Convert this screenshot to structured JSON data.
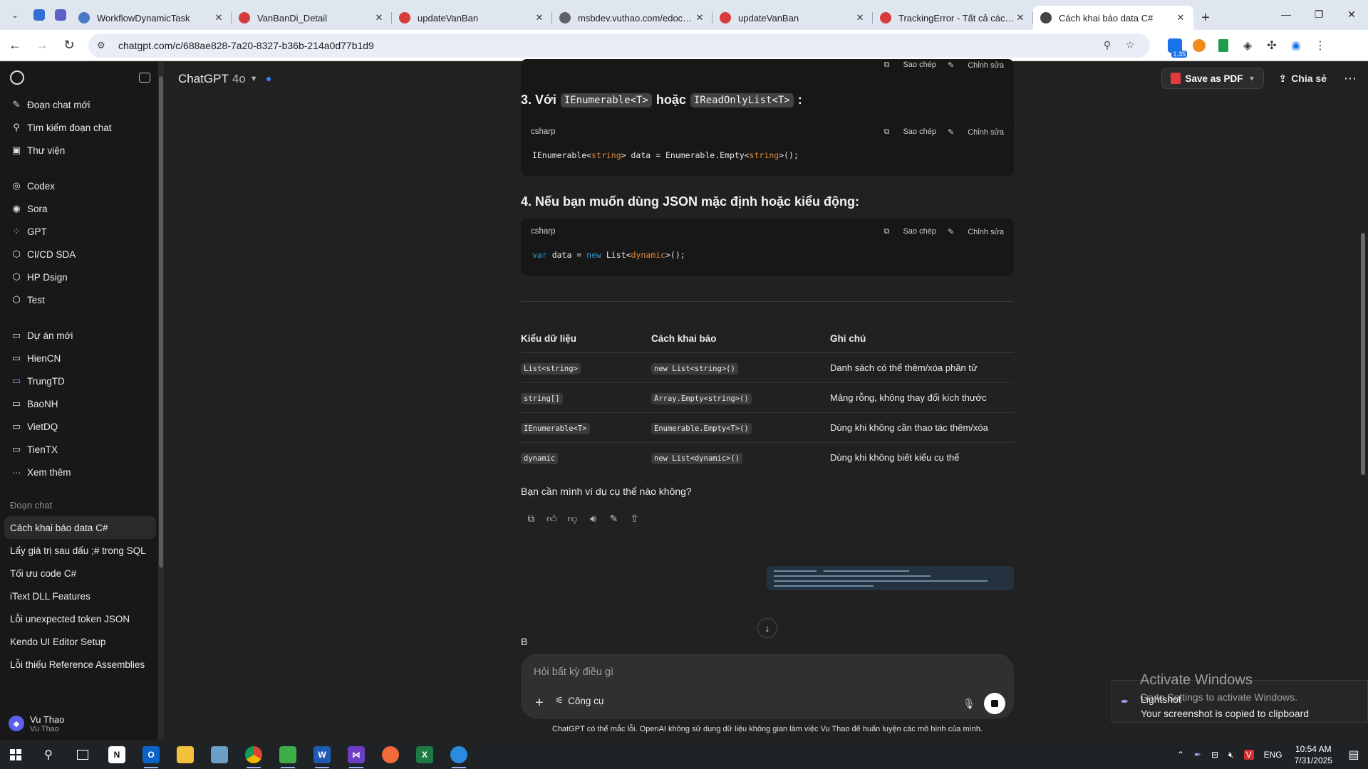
{
  "browser": {
    "tabs": [
      {
        "title": "WorkflowDynamicTask",
        "favicon_color": "#4a78c2"
      },
      {
        "title": "VanBanDi_Detail",
        "favicon_color": "#d83b3b"
      },
      {
        "title": "updateVanBan",
        "favicon_color": "#d83b3b"
      },
      {
        "title": "msbdev.vuthao.com/edoc/va",
        "favicon_color": "#5f6368"
      },
      {
        "title": "updateVanBan",
        "favicon_color": "#d83b3b"
      },
      {
        "title": "TrackingError - Tất cả các Kh",
        "favicon_color": "#d83b3b"
      },
      {
        "title": "Cách khai báo data C#",
        "favicon_color": "#444444"
      }
    ],
    "url": "chatgpt.com/c/688ae828-7a20-8327-b36b-214a0d77b1d9",
    "extension_badge": "1.35",
    "close_glyph": "✕",
    "new_tab_glyph": "+"
  },
  "sidebar": {
    "top_items": [
      {
        "label": "Đoạn chat mới",
        "icon": "✎"
      },
      {
        "label": "Tìm kiếm đoạn chat",
        "icon": "⚲"
      },
      {
        "label": "Thư viện",
        "icon": "▣"
      }
    ],
    "gpt_items": [
      {
        "label": "Codex",
        "icon": "◎"
      },
      {
        "label": "Sora",
        "icon": "◉"
      },
      {
        "label": "GPT",
        "icon": "⁘"
      },
      {
        "label": "CI/CD SDA",
        "icon": "⬡"
      },
      {
        "label": "HP Dsign",
        "icon": "⬡"
      },
      {
        "label": "Test",
        "icon": "⬡"
      }
    ],
    "project_items": [
      {
        "label": "Dự án mới",
        "icon": "▭"
      },
      {
        "label": "HienCN",
        "icon": "▭"
      },
      {
        "label": "TrungTD",
        "icon": "▭"
      },
      {
        "label": "BaoNH",
        "icon": "▭"
      },
      {
        "label": "VietDQ",
        "icon": "▭"
      },
      {
        "label": "TienTX",
        "icon": "▭"
      },
      {
        "label": "Xem thêm",
        "icon": "···"
      }
    ],
    "chats_section": "Đoạn chat",
    "chats": [
      "Cách khai báo data C#",
      "Lấy giá trị sau dấu ;# trong SQL",
      "Tối ưu code C#",
      "iText DLL Features",
      "Lỗi unexpected token JSON",
      "Kendo UI Editor Setup",
      "Lỗi thiếu Reference Assemblies"
    ],
    "user": {
      "name": "Vu Thao",
      "plan": "Vu Thao"
    }
  },
  "header": {
    "model": "ChatGPT",
    "version": "4o",
    "save_pdf": "Save as PDF",
    "share": "Chia sẻ"
  },
  "codeblock_labels": {
    "lang": "csharp",
    "copy": "Sao chép",
    "edit": "Chỉnh sửa"
  },
  "sections": [
    {
      "prefix": "3. Với",
      "code1": "IEnumerable<T>",
      "middle": "hoặc",
      "code2": "IReadOnlyList<T>",
      "suffix": ":"
    },
    {
      "heading": "4. Nếu bạn muốn dùng JSON mặc định hoặc kiểu động:"
    }
  ],
  "table": {
    "headers": [
      "Kiểu dữ liệu",
      "Cách khai báo",
      "Ghi chú"
    ],
    "rows": [
      [
        "List<string>",
        "new List<string>()",
        "Danh sách có thể thêm/xóa phần tử"
      ],
      [
        "string[]",
        "Array.Empty<string>()",
        "Mảng rỗng, không thay đổi kích thước"
      ],
      [
        "IEnumerable<T>",
        "Enumerable.Empty<T>()",
        "Dùng khi không cần thao tác thêm/xóa"
      ],
      [
        "dynamic",
        "new List<dynamic>()",
        "Dùng khi không biết kiểu cụ thể"
      ]
    ]
  },
  "followup": "Bạn cần mình ví dụ cụ thể nào không?",
  "user_message": "B",
  "composer": {
    "placeholder": "Hỏi bất kỳ điều gì",
    "tools": "Công cụ"
  },
  "footnote": "ChatGPT có thể mắc lỗi. OpenAI không sử dụng dữ liệu không gian làm việc Vu Thao để huấn luyện các mô hình của mình.",
  "toast": {
    "title": "Lightshot",
    "message": "Your screenshot is copied to clipboard"
  },
  "watermark": {
    "line1": "Activate Windows",
    "line2": "Go to Settings to activate Windows."
  },
  "taskbar": {
    "lang": "ENG",
    "time": "10:54 AM",
    "date": "7/31/2025"
  }
}
